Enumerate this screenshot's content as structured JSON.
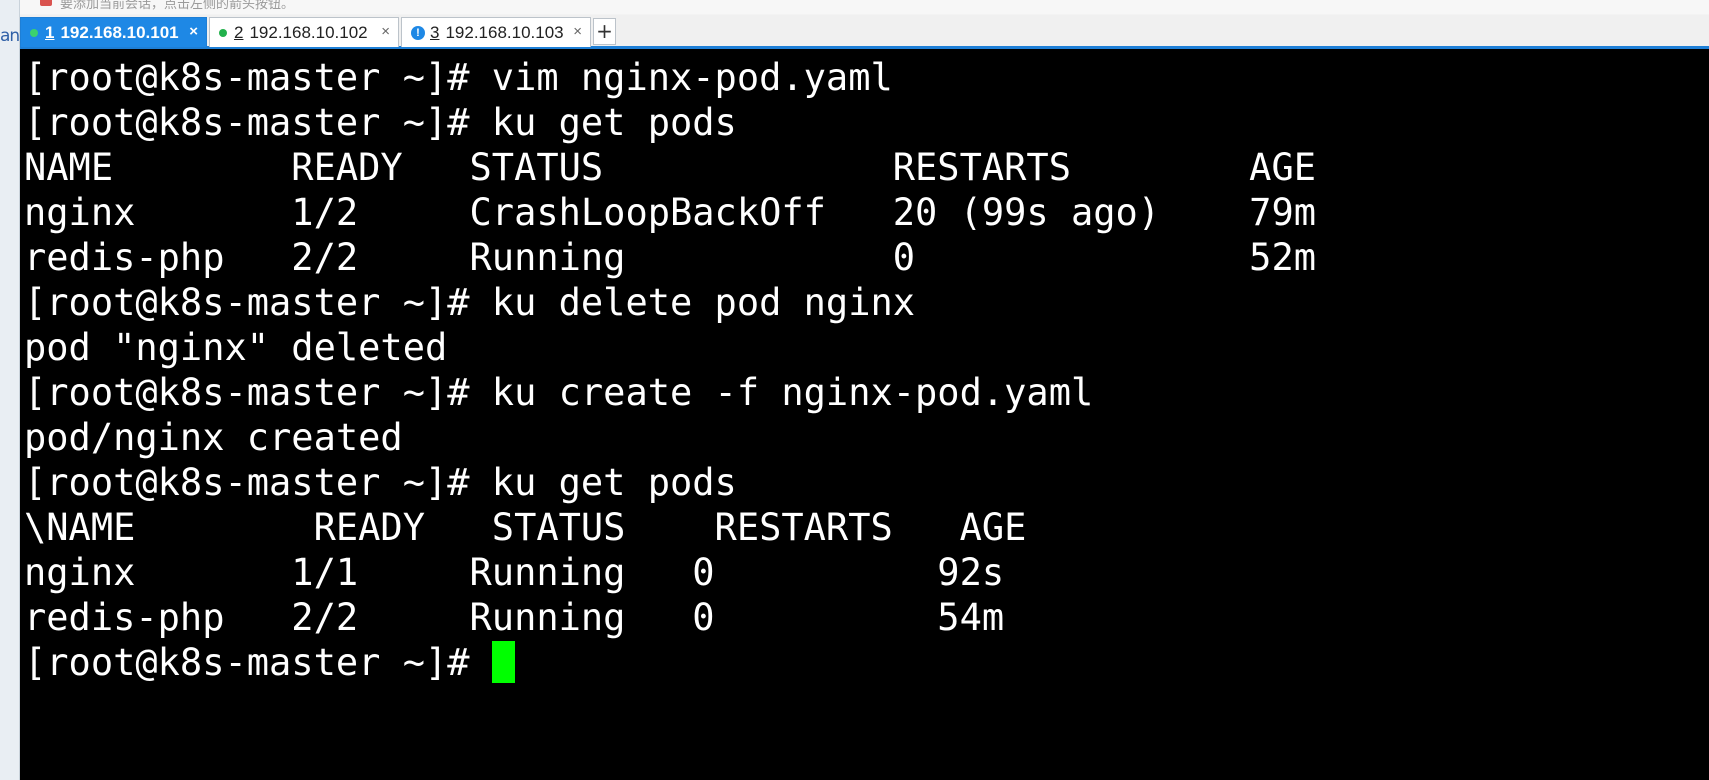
{
  "notice_bar": {
    "text": "要添加当前会话，点击左侧的箭头按钮。"
  },
  "left_strip": {
    "edge_text": "an"
  },
  "tabs": [
    {
      "number": "1",
      "host": "192.168.10.101",
      "status": "connected",
      "active": true,
      "close": "×"
    },
    {
      "number": "2",
      "host": "192.168.10.102",
      "status": "connected",
      "active": false,
      "close": "×"
    },
    {
      "number": "3",
      "host": "192.168.10.103",
      "status": "alert",
      "active": false,
      "close": "×"
    }
  ],
  "add_tab_label": "+",
  "terminal": {
    "lines": [
      "[root@k8s-master ~]# vim nginx-pod.yaml",
      "[root@k8s-master ~]# ku get pods",
      "NAME        READY   STATUS             RESTARTS        AGE",
      "nginx       1/2     CrashLoopBackOff   20 (99s ago)    79m",
      "redis-php   2/2     Running            0               52m",
      "[root@k8s-master ~]# ku delete pod nginx",
      "pod \"nginx\" deleted",
      "[root@k8s-master ~]# ku create -f nginx-pod.yaml",
      "pod/nginx created",
      "[root@k8s-master ~]# ku get pods",
      "\\NAME        READY   STATUS    RESTARTS   AGE",
      "nginx       1/1     Running   0          92s",
      "redis-php   2/2     Running   0          54m"
    ],
    "prompt": "[root@k8s-master ~]# ",
    "cursor_color": "#00ff00",
    "background": "#000000",
    "foreground": "#ffffff"
  },
  "colors": {
    "tab_active": "#1e88e5",
    "status_connected": "#22b14c",
    "status_alert": "#1e88e5"
  }
}
